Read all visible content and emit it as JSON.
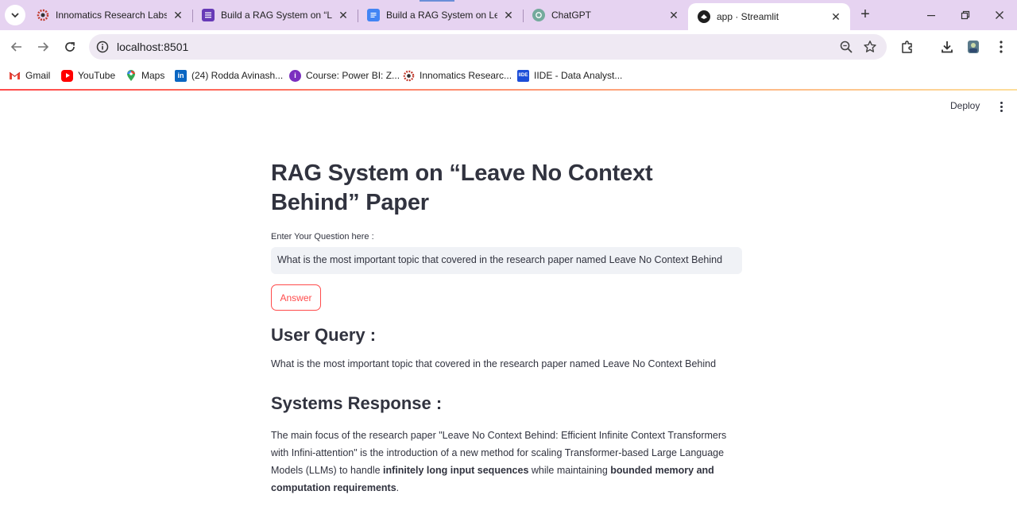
{
  "browser": {
    "tabs": [
      {
        "title": "Innomatics Research Labs",
        "icon": "innomatics-icon"
      },
      {
        "title": "Build a RAG System on “Lea",
        "icon": "docs-form-icon"
      },
      {
        "title": "Build a RAG System on Leav",
        "icon": "google-docs-icon"
      },
      {
        "title": "ChatGPT",
        "icon": "chatgpt-icon"
      },
      {
        "title": "app · Streamlit",
        "icon": "streamlit-icon",
        "active": true
      }
    ],
    "url": "localhost:8501",
    "bookmarks": [
      {
        "label": "Gmail",
        "icon": "gmail-icon"
      },
      {
        "label": "YouTube",
        "icon": "youtube-icon"
      },
      {
        "label": "Maps",
        "icon": "maps-icon"
      },
      {
        "label": "(24) Rodda Avinash...",
        "icon": "linkedin-icon"
      },
      {
        "label": "Course: Power BI: Z...",
        "icon": "course-icon"
      },
      {
        "label": "Innomatics Researc...",
        "icon": "innomatics-icon"
      },
      {
        "label": "IIDE - Data Analyst...",
        "icon": "iide-icon"
      }
    ],
    "colors": {
      "tabstrip": "#e6d3f1",
      "omnibox": "#efe9f3"
    }
  },
  "streamlit": {
    "deploy_label": "Deploy",
    "accent": "#ff4b4b"
  },
  "app": {
    "title": "RAG System on “Leave No Context Behind” Paper",
    "question_label": "Enter Your Question here :",
    "question_value": "What is the most important topic that covered in the research paper named Leave No Context Behind",
    "answer_button": "Answer",
    "user_query_heading": "User Query :",
    "user_query_text": "What is the most important topic that covered in the research paper named Leave No Context Behind",
    "response_heading": "Systems Response :",
    "response": {
      "part1": "The main focus of the research paper \"Leave No Context Behind: Efficient Infinite Context Transformers with Infini-attention\" is the introduction of a new method for scaling Transformer-based Large Language Models (LLMs) to handle ",
      "bold1": "infinitely long input sequences",
      "part2": " while maintaining ",
      "bold2": "bounded memory and computation requirements",
      "part3": "."
    }
  }
}
